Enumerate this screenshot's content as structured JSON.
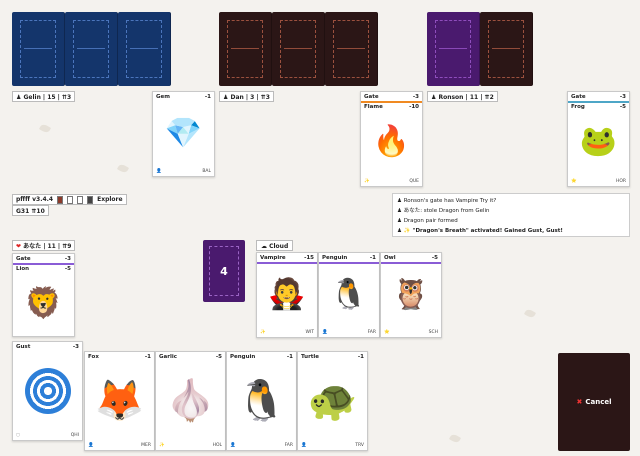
{
  "opponents": [
    {
      "tag": "Gelin | 15 | ⇈3"
    },
    {
      "tag": "Dan | 3 | ⇈3"
    },
    {
      "tag": "Ronson | 11 | ⇈2"
    }
  ],
  "opponent_cards": [
    {
      "name": "Gem",
      "cost": "-1",
      "code": "BAL",
      "icon": "gem-icon"
    },
    {
      "class": "Gate",
      "class_cost": "-3",
      "name": "Flame",
      "cost": "-10",
      "code": "QUE",
      "icon": "flame-icon"
    },
    {
      "class": "Gate",
      "class_cost": "-3",
      "name": "Frog",
      "cost": "-5",
      "code": "HOR",
      "icon": "frog-icon"
    }
  ],
  "version": {
    "label": "pffff v3.4.4",
    "explore": "Explore",
    "round": "G31 ⇈10"
  },
  "log": [
    "Ronson's gate has Vampire Try it?",
    "あなた: stole Dragon from Gelin",
    "Dragon pair formed",
    "\"Dragon's Breath\" activated! Gained Gust, Gust!"
  ],
  "self": {
    "tag": "あなた | 11 | ⇈9"
  },
  "self_gate": {
    "class": "Gate",
    "class_cost": "-3",
    "name": "Lion",
    "cost": "-5",
    "icon": "lion-icon"
  },
  "center": {
    "deck_count": "4",
    "weather": "Cloud"
  },
  "field_cards": [
    {
      "name": "Vampire",
      "cost": "-15",
      "code": "WIT",
      "icon": "vampire-icon"
    },
    {
      "name": "Penguin",
      "cost": "-1",
      "code": "FAR",
      "icon": "penguin-icon"
    },
    {
      "name": "Owl",
      "cost": "-5",
      "code": "SCH",
      "icon": "owl-icon"
    }
  ],
  "hand": [
    {
      "name": "Gust",
      "cost": "-3",
      "code": "QHI",
      "icon": "gust-icon"
    },
    {
      "name": "Fox",
      "cost": "-1",
      "code": "MER",
      "icon": "fox-icon"
    },
    {
      "name": "Garlic",
      "cost": "-5",
      "code": "HOL",
      "icon": "garlic-icon"
    },
    {
      "name": "Penguin",
      "cost": "-1",
      "code": "FAR",
      "icon": "penguin-icon"
    },
    {
      "name": "Turtle",
      "cost": "-1",
      "code": "TRV",
      "icon": "turtle-icon"
    }
  ],
  "cancel": {
    "label": "Cancel"
  },
  "colors": {
    "blue_deck": "#14356b",
    "dark_deck": "#2b1616",
    "purple_deck": "#4a1a6e",
    "gate_accent": "#7c5bd6"
  }
}
